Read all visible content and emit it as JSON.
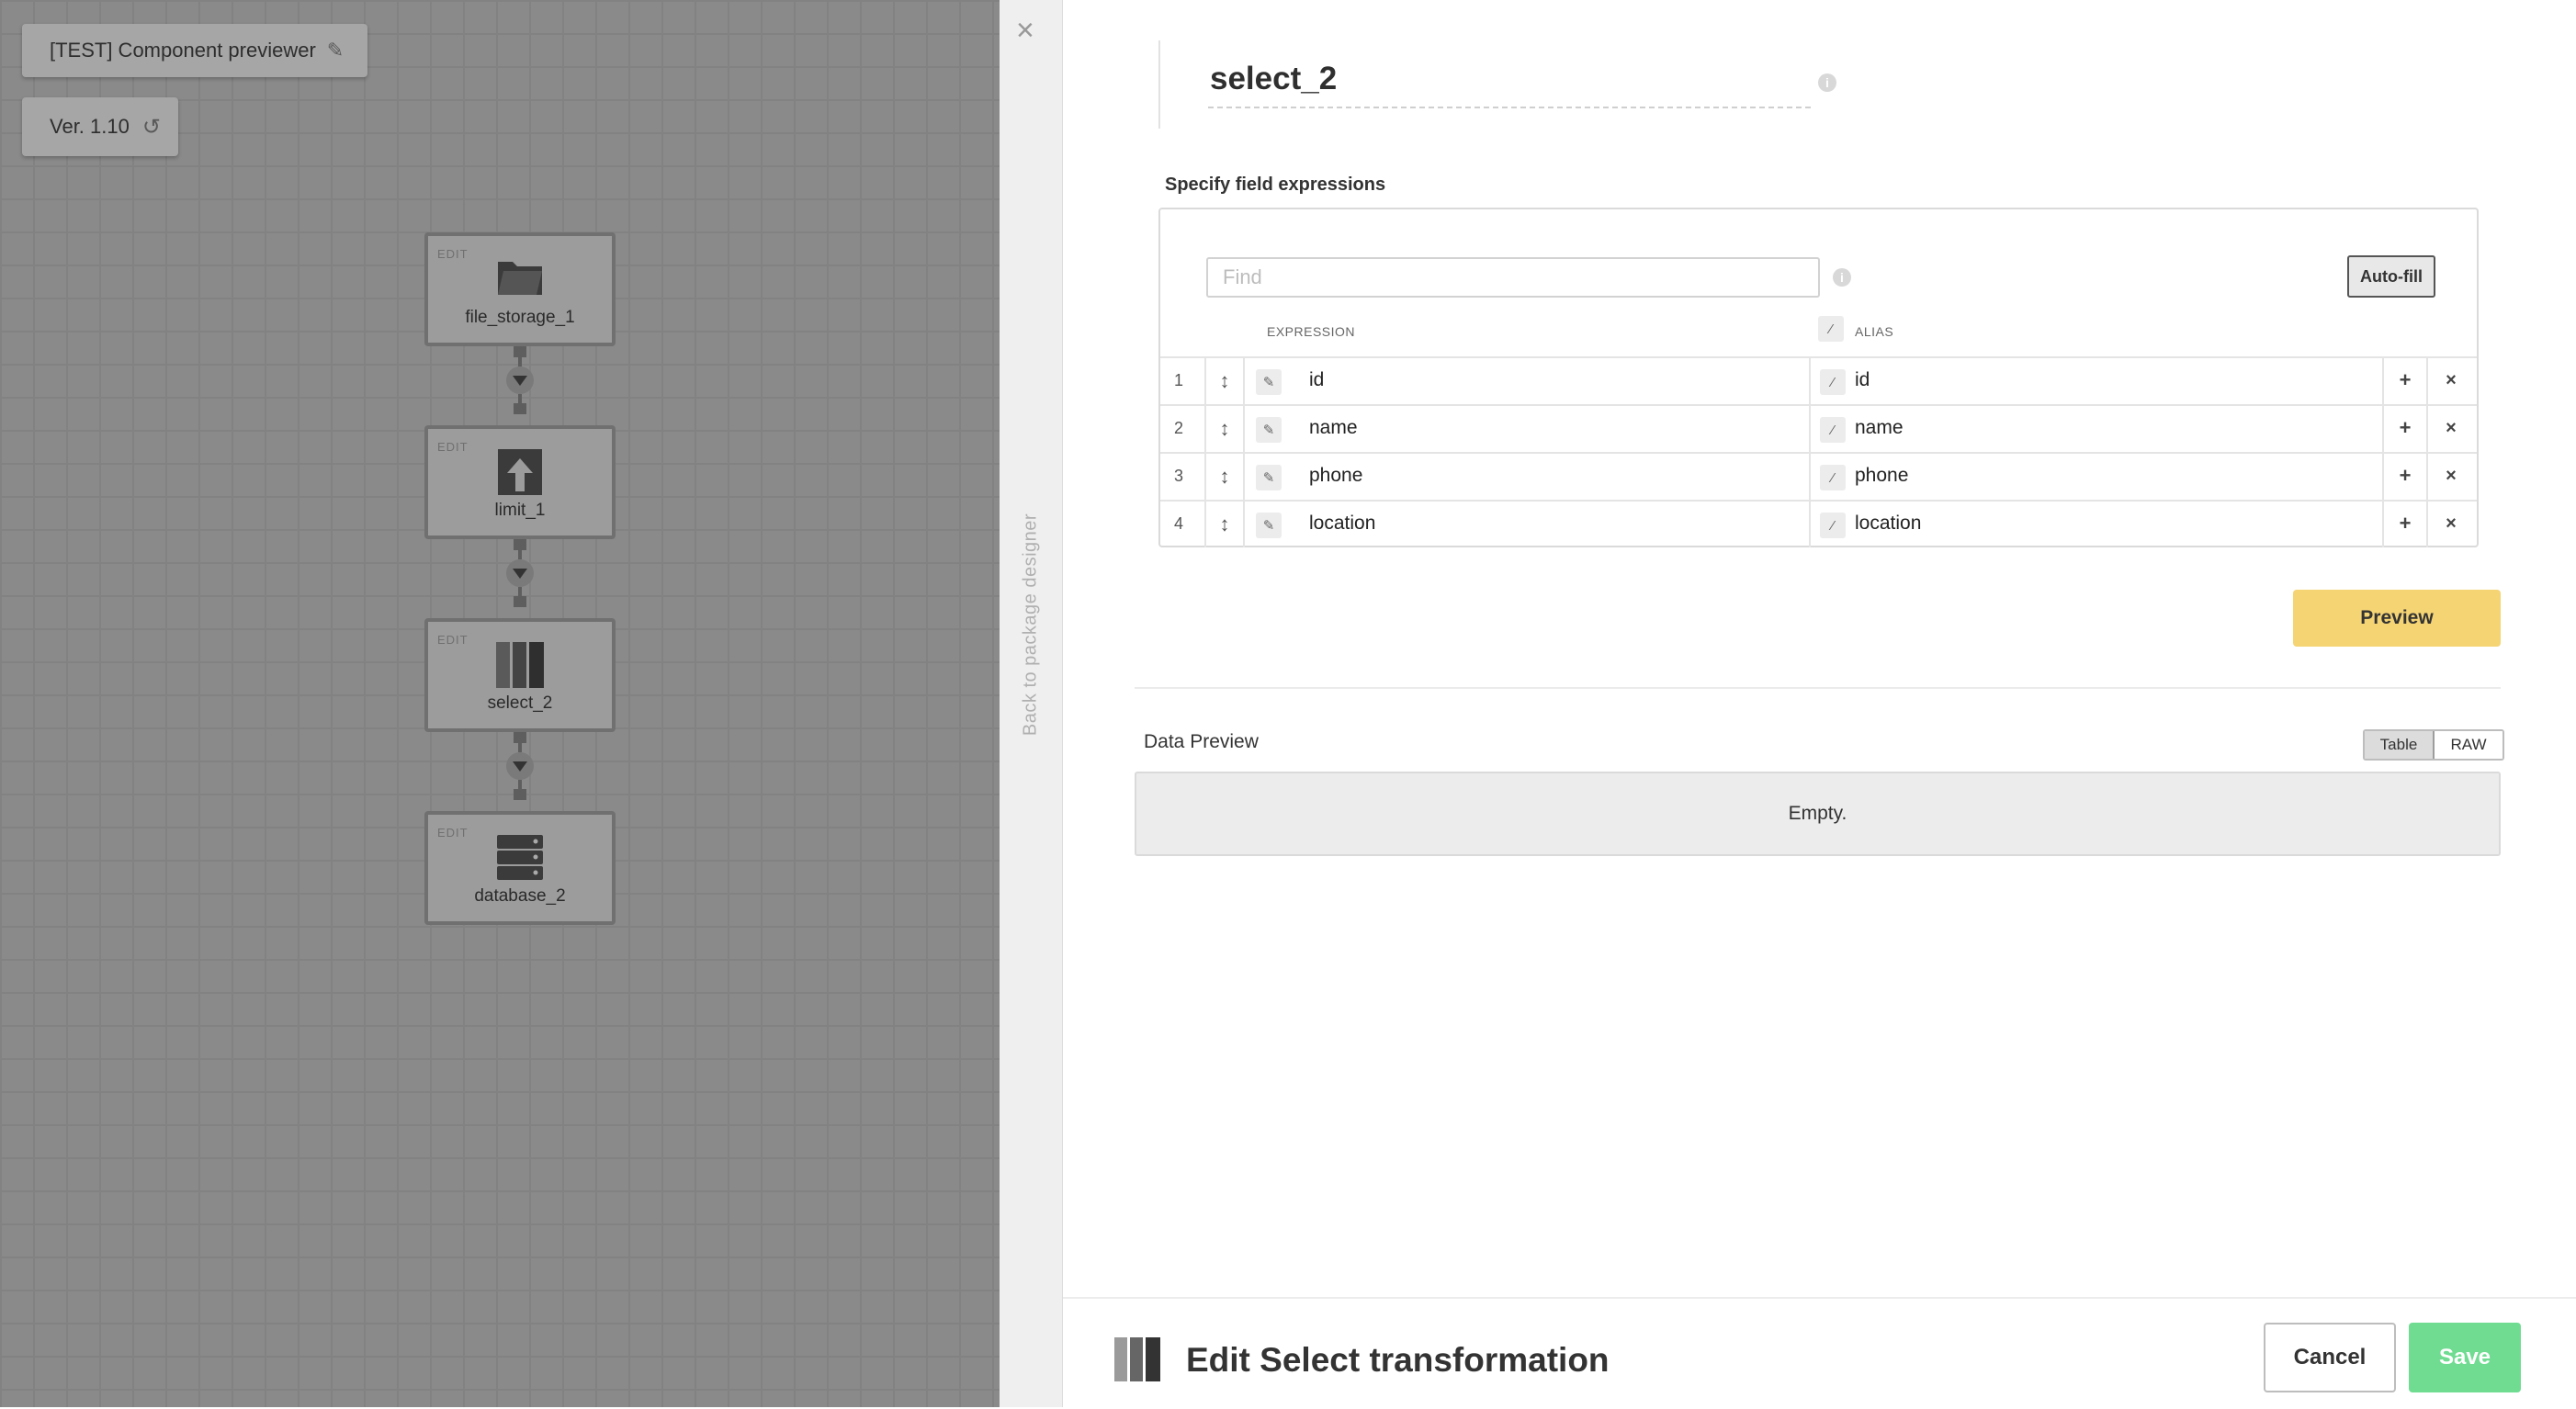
{
  "canvas": {
    "title": "[TEST] Component previewer",
    "version": "Ver. 1.10",
    "nodes": [
      {
        "edit": "EDIT",
        "label": "file_storage_1",
        "icon": "folder-icon"
      },
      {
        "edit": "EDIT",
        "label": "limit_1",
        "icon": "upload-arrow-icon"
      },
      {
        "edit": "EDIT",
        "label": "select_2",
        "icon": "columns-icon"
      },
      {
        "edit": "EDIT",
        "label": "database_2",
        "icon": "database-icon"
      }
    ]
  },
  "strip": {
    "close": "×",
    "back_label": "Back to package designer"
  },
  "panel": {
    "component_name": "select_2",
    "fields_title": "Specify field expressions",
    "find_placeholder": "Find",
    "autofill_label": "Auto-fill",
    "col_expression": "EXPRESSION",
    "col_alias": "ALIAS",
    "rows": [
      {
        "num": "1",
        "expression": "id",
        "alias": "id"
      },
      {
        "num": "2",
        "expression": "name",
        "alias": "name"
      },
      {
        "num": "3",
        "expression": "phone",
        "alias": "phone"
      },
      {
        "num": "4",
        "expression": "location",
        "alias": "location"
      }
    ],
    "preview_label": "Preview",
    "data_preview_title": "Data Preview",
    "view_table": "Table",
    "view_raw": "RAW",
    "data_preview_empty": "Empty."
  },
  "footer": {
    "title": "Edit Select transformation",
    "cancel_label": "Cancel",
    "save_label": "Save"
  },
  "colors": {
    "preview_button": "#f5d474",
    "save_button": "#6fdc92",
    "canvas_bg": "#8a8a8a"
  }
}
